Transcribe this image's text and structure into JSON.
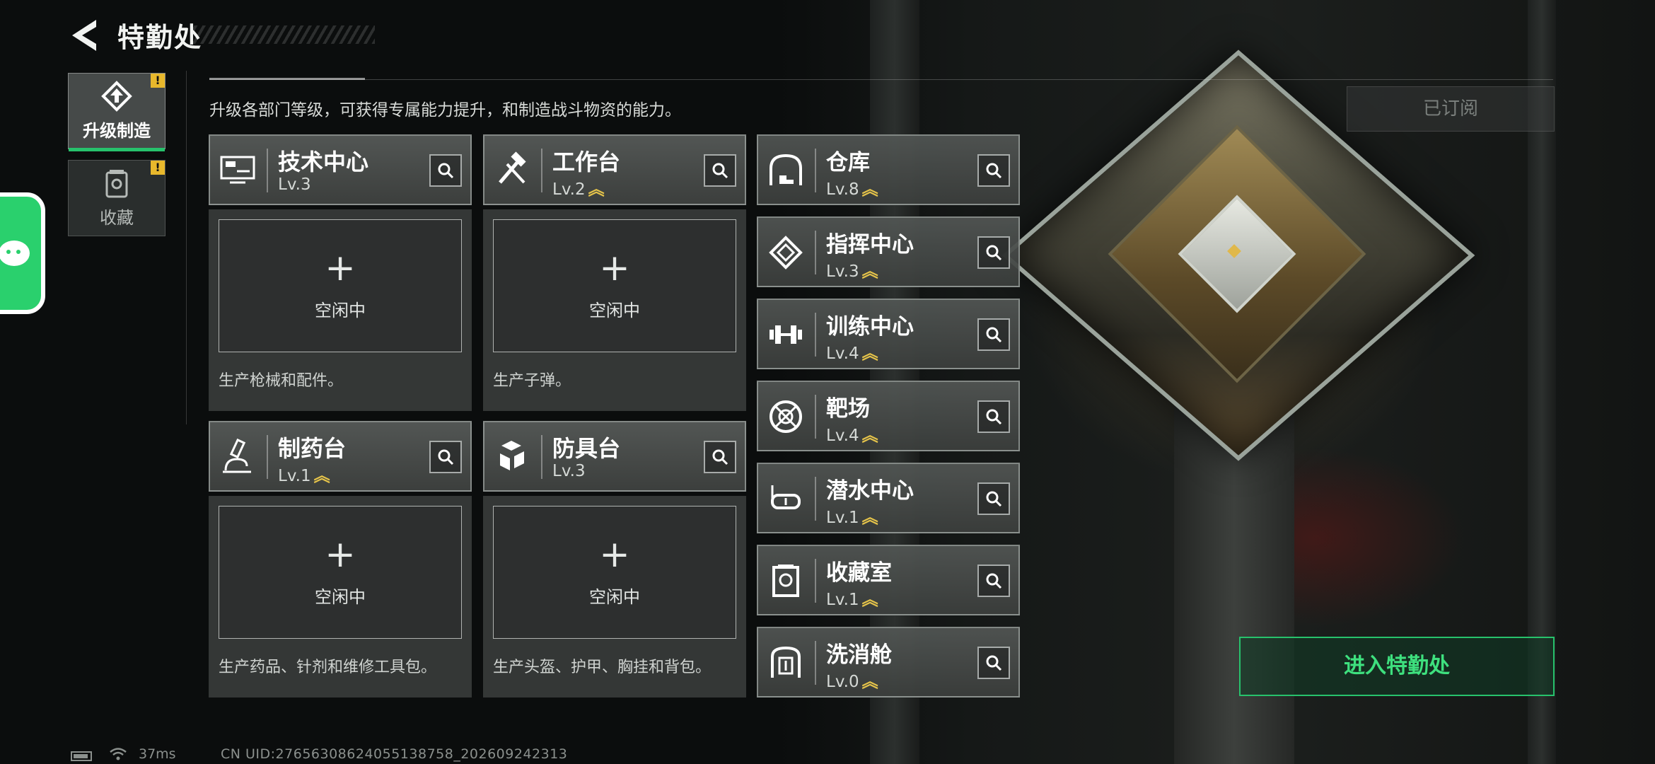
{
  "header": {
    "title": "特勤处"
  },
  "subtitle": "升级各部门等级，可获得专属能力提升，和制造战斗物资的能力。",
  "side_tabs": [
    {
      "label": "升级制造",
      "icon": "upgrade-icon",
      "active": true,
      "alert": "!"
    },
    {
      "label": "收藏",
      "icon": "collection-icon",
      "active": false,
      "alert": "!"
    }
  ],
  "workstations": [
    {
      "name": "技术中心",
      "level": "Lv.3",
      "upgradable": false,
      "icon": "tech-center-icon",
      "slot_plus": "+",
      "slot_status": "空闲中",
      "description": "生产枪械和配件。"
    },
    {
      "name": "工作台",
      "level": "Lv.2",
      "upgradable": true,
      "icon": "workbench-icon",
      "slot_plus": "+",
      "slot_status": "空闲中",
      "description": "生产子弹。"
    },
    {
      "name": "制药台",
      "level": "Lv.1",
      "upgradable": true,
      "icon": "pharmacy-icon",
      "slot_plus": "+",
      "slot_status": "空闲中",
      "description": "生产药品、针剂和维修工具包。"
    },
    {
      "name": "防具台",
      "level": "Lv.3",
      "upgradable": false,
      "icon": "armor-bench-icon",
      "slot_plus": "+",
      "slot_status": "空闲中",
      "description": "生产头盔、护甲、胸挂和背包。"
    }
  ],
  "facilities": [
    {
      "name": "仓库",
      "level": "Lv.8",
      "upgradable": true,
      "icon": "warehouse-icon"
    },
    {
      "name": "指挥中心",
      "level": "Lv.3",
      "upgradable": true,
      "icon": "command-center-icon"
    },
    {
      "name": "训练中心",
      "level": "Lv.4",
      "upgradable": true,
      "icon": "training-center-icon"
    },
    {
      "name": "靶场",
      "level": "Lv.4",
      "upgradable": true,
      "icon": "shooting-range-icon"
    },
    {
      "name": "潜水中心",
      "level": "Lv.1",
      "upgradable": true,
      "icon": "diving-center-icon"
    },
    {
      "name": "收藏室",
      "level": "Lv.1",
      "upgradable": true,
      "icon": "collection-room-icon"
    },
    {
      "name": "洗消舱",
      "level": "Lv.0",
      "upgradable": true,
      "icon": "decon-chamber-icon"
    }
  ],
  "upgrade_marker": "︽",
  "buttons": {
    "subscribed": "已订阅",
    "enter": "进入特勤处"
  },
  "footer": {
    "ping": "37ms",
    "uid": "CN UID:27656308624055138758_202609242313"
  },
  "colors": {
    "accent": "#27c26c",
    "upgrade": "#e6c44a",
    "alert": "#e8b82c",
    "wechat": "#2ad06d"
  }
}
